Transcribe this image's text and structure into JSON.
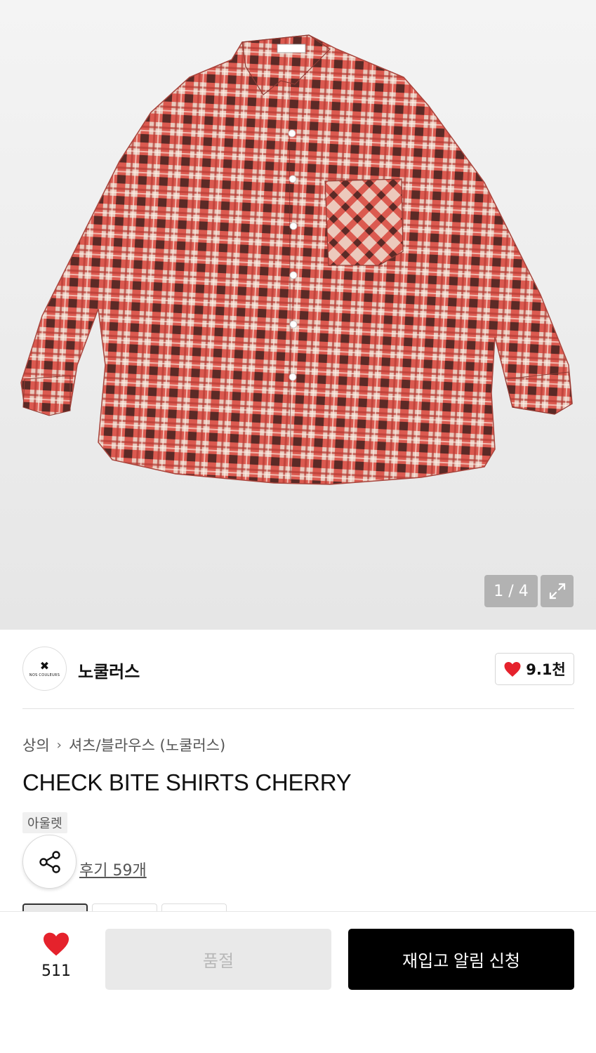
{
  "gallery": {
    "image_alt": "red plaid check shirt",
    "counter": "1 / 4"
  },
  "brand": {
    "logo_text": "NOS COULEURS",
    "name": "노쿨러스",
    "likes": "9.1천"
  },
  "breadcrumb": {
    "category": "상의",
    "subcategory": "셔츠/블라우스 (노쿨러스)"
  },
  "product": {
    "title": "CHECK BITE SHIRTS CHERRY",
    "tag": "아울렛",
    "review_link": "후기 59개"
  },
  "bottom_bar": {
    "wish_count": "511",
    "soldout_label": "품절",
    "restock_label": "재입고 알림 신청"
  },
  "colors": {
    "heart": "#e5222c",
    "restock_bg": "#000000",
    "soldout_bg": "#e9e9e9"
  }
}
